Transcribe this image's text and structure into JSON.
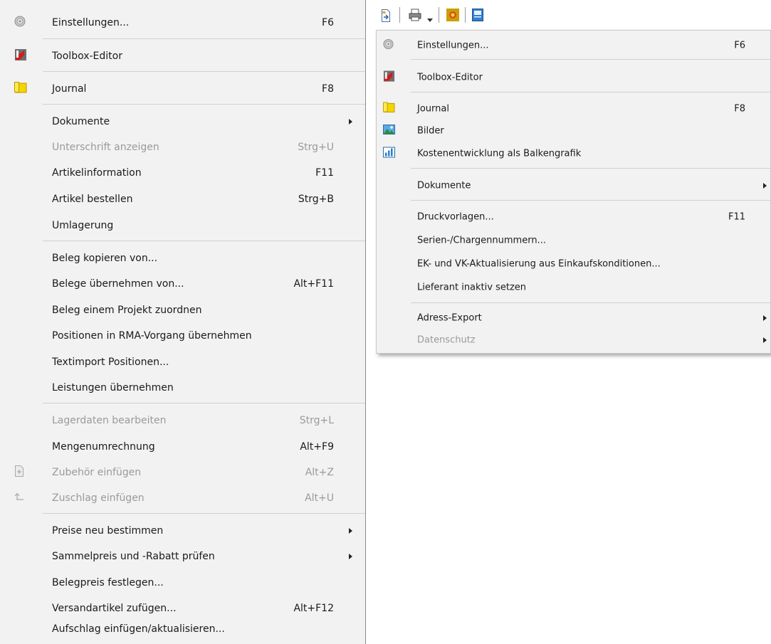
{
  "left_menu": {
    "items": [
      {
        "label": "Einstellungen...",
        "shortcut": "F6",
        "icon": "settings-disc-icon"
      },
      {
        "label": "Toolbox-Editor",
        "shortcut": "",
        "icon": "toolbox-icon"
      },
      {
        "label": "Journal",
        "shortcut": "F8",
        "icon": "journal-icon"
      },
      {
        "label": "Dokumente",
        "shortcut": ""
      },
      {
        "label": "Unterschrift anzeigen",
        "shortcut": "Strg+U"
      },
      {
        "label": "Artikelinformation",
        "shortcut": "F11"
      },
      {
        "label": "Artikel bestellen",
        "shortcut": "Strg+B"
      },
      {
        "label": "Umlagerung",
        "shortcut": ""
      },
      {
        "label": "Beleg kopieren von...",
        "shortcut": ""
      },
      {
        "label": "Belege übernehmen von...",
        "shortcut": "Alt+F11"
      },
      {
        "label": "Beleg einem Projekt zuordnen",
        "shortcut": ""
      },
      {
        "label": "Positionen in RMA-Vorgang übernehmen",
        "shortcut": ""
      },
      {
        "label": "Textimport Positionen...",
        "shortcut": ""
      },
      {
        "label": "Leistungen übernehmen",
        "shortcut": ""
      },
      {
        "label": "Lagerdaten bearbeiten",
        "shortcut": "Strg+L"
      },
      {
        "label": "Mengenumrechnung",
        "shortcut": "Alt+F9"
      },
      {
        "label": "Zubehör einfügen",
        "shortcut": "Alt+Z",
        "icon": "add-accessory-icon"
      },
      {
        "label": "Zuschlag einfügen",
        "shortcut": "Alt+U",
        "icon": "surcharge-arrow-icon"
      },
      {
        "label": "Preise neu bestimmen",
        "shortcut": ""
      },
      {
        "label": "Sammelpreis und -Rabatt prüfen",
        "shortcut": ""
      },
      {
        "label": "Belegpreis festlegen...",
        "shortcut": ""
      },
      {
        "label": "Versandartikel zufügen...",
        "shortcut": "Alt+F12"
      },
      {
        "label": "Aufschlag einfügen/aktualisieren...",
        "shortcut": ""
      }
    ]
  },
  "right_menu": {
    "toolbar_icons": [
      "document-export-icon",
      "printer-icon",
      "dropdown-arrow-icon",
      "sun-icon",
      "blue-book-icon"
    ],
    "items": [
      {
        "label": "Einstellungen...",
        "shortcut": "F6",
        "icon": "settings-disc-icon"
      },
      {
        "label": "Toolbox-Editor",
        "shortcut": "",
        "icon": "toolbox-icon"
      },
      {
        "label": "Journal",
        "shortcut": "F8",
        "icon": "journal-icon"
      },
      {
        "label": "Bilder",
        "shortcut": "",
        "icon": "pictures-icon"
      },
      {
        "label": "Kostenentwicklung als Balkengrafik",
        "shortcut": "",
        "icon": "bar-chart-icon"
      },
      {
        "label": "Dokumente",
        "shortcut": ""
      },
      {
        "label": "Druckvorlagen...",
        "shortcut": "F11"
      },
      {
        "label": "Serien-/Chargennummern...",
        "shortcut": ""
      },
      {
        "label": "EK- und VK-Aktualisierung aus Einkaufskonditionen...",
        "shortcut": ""
      },
      {
        "label": "Lieferant inaktiv setzen",
        "shortcut": ""
      },
      {
        "label": "Adress-Export",
        "shortcut": ""
      },
      {
        "label": "Datenschutz",
        "shortcut": ""
      }
    ]
  },
  "colors": {
    "menu_bg": "#f2f2f2",
    "disabled_text": "#9a9a9a",
    "separator": "#d0d0d0"
  }
}
